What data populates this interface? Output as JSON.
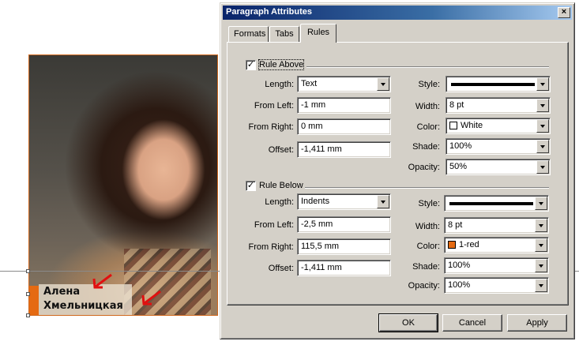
{
  "background": {
    "caption_line1": "Алена",
    "caption_line2": "Хмельницкая",
    "accent_color": "#e56a12"
  },
  "dialog": {
    "title": "Paragraph Attributes",
    "close_glyph": "×",
    "tabs": [
      {
        "label": "Formats",
        "active": false
      },
      {
        "label": "Tabs",
        "active": false
      },
      {
        "label": "Rules",
        "active": true
      }
    ],
    "rule_above": {
      "checkbox_label": "Rule Above",
      "checked": true,
      "length_label": "Length:",
      "length_value": "Text",
      "from_left_label": "From Left:",
      "from_left_value": "-1 mm",
      "from_right_label": "From Right:",
      "from_right_value": "0 mm",
      "offset_label": "Offset:",
      "offset_value": "-1,411 mm",
      "style_label": "Style:",
      "width_label": "Width:",
      "width_value": "8 pt",
      "color_label": "Color:",
      "color_value": "White",
      "color_swatch": "#ffffff",
      "shade_label": "Shade:",
      "shade_value": "100%",
      "opacity_label": "Opacity:",
      "opacity_value": "50%"
    },
    "rule_below": {
      "checkbox_label": "Rule Below",
      "checked": true,
      "length_label": "Length:",
      "length_value": "Indents",
      "from_left_label": "From Left:",
      "from_left_value": "-2,5 mm",
      "from_right_label": "From Right:",
      "from_right_value": "115,5 mm",
      "offset_label": "Offset:",
      "offset_value": "-1,411 mm",
      "style_label": "Style:",
      "width_label": "Width:",
      "width_value": "8 pt",
      "color_label": "Color:",
      "color_value": "1-red",
      "color_swatch": "#e56a12",
      "shade_label": "Shade:",
      "shade_value": "100%",
      "opacity_label": "Opacity:",
      "opacity_value": "100%"
    },
    "buttons": {
      "ok": "OK",
      "cancel": "Cancel",
      "apply": "Apply"
    }
  }
}
